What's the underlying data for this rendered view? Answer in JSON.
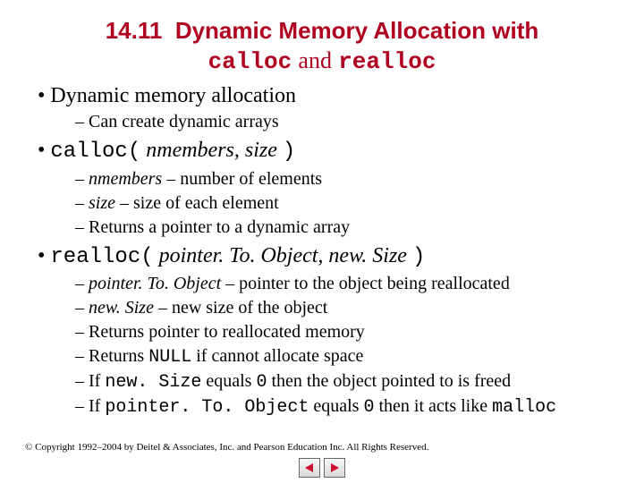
{
  "title": {
    "number": "14.11",
    "text": "Dynamic Memory Allocation with",
    "code1": "calloc",
    "and": "and",
    "code2": "realloc"
  },
  "bullets": {
    "b1": {
      "text": "Dynamic memory allocation"
    },
    "b1s": {
      "a": "Can create dynamic arrays"
    },
    "b2": {
      "code_open": "calloc(",
      "args": "nmembers, size",
      "code_close": ")"
    },
    "b2s": {
      "a_i": "nmembers",
      "a_t": " – number of elements",
      "b_i": "size",
      "b_t": " – size of each element",
      "c": "Returns a pointer to a dynamic array"
    },
    "b3": {
      "code_open": "realloc(",
      "args": "pointer. To. Object, new. Size",
      "code_close": ")"
    },
    "b3s": {
      "a_i": "pointer. To. Object",
      "a_t": " – pointer to the object being reallocated",
      "b_i": "new. Size",
      "b_t": " – new size of the object",
      "c": "Returns pointer to reallocated memory",
      "d_pre": "Returns ",
      "d_code": "NULL",
      "d_post": " if cannot allocate space",
      "e_pre": "If ",
      "e_code": "new. Size",
      "e_mid": " equals ",
      "e_code2": "0",
      "e_post": " then the object pointed to is freed",
      "f_pre": "If ",
      "f_code": "pointer. To. Object",
      "f_mid": " equals ",
      "f_code2": "0",
      "f_post": " then it acts like ",
      "f_code3": "malloc"
    }
  },
  "footer": "© Copyright 1992–2004 by Deitel & Associates, Inc. and Pearson Education Inc. All Rights Reserved.",
  "colors": {
    "accent": "#b00020",
    "nav_arrow": "#c8102e"
  }
}
